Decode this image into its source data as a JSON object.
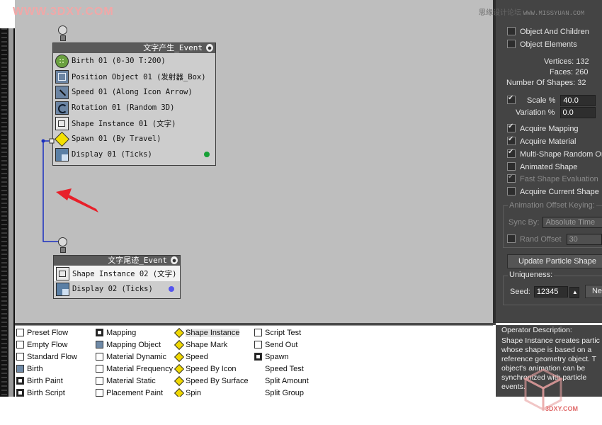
{
  "watermark": {
    "left": "WWW.3DXY.COM",
    "right_cn": "思缘设计论坛",
    "right_site": "WWW.MISSYUAN.COM",
    "logo_sub": "3DXY.COM"
  },
  "event1": {
    "title": "文字产生_Event",
    "ops": [
      {
        "label": "Birth 01 (0-30 T:200)",
        "icon": "birth-icon"
      },
      {
        "label": "Position Object 01 (发射器_Box)",
        "icon": "position-object-icon"
      },
      {
        "label": "Speed 01 (Along Icon Arrow)",
        "icon": "speed-icon"
      },
      {
        "label": "Rotation 01 (Random 3D)",
        "icon": "rotation-icon"
      },
      {
        "label": "Shape Instance 01 (文字)",
        "icon": "shape-instance-icon"
      },
      {
        "label": "Spawn 01 (By Travel)",
        "icon": "spawn-icon"
      },
      {
        "label": "Display 01 (Ticks)",
        "icon": "display-icon"
      }
    ],
    "display_color": "#16a036"
  },
  "event2": {
    "title": "文字尾迹_Event",
    "ops": [
      {
        "label": "Shape Instance 02 (文字)",
        "icon": "shape-instance-icon"
      },
      {
        "label": "Display 02 (Ticks)",
        "icon": "display-icon"
      }
    ],
    "display_color": "#5555ee"
  },
  "wire_color": "#1a2fbf",
  "annotation_arrow_color": "#e8202a",
  "panel": {
    "object_and_children": "Object And Children",
    "object_elements": "Object Elements",
    "vertices_label": "Vertices:",
    "vertices_value": "132",
    "faces_label": "Faces:",
    "faces_value": "260",
    "num_shapes_label": "Number Of Shapes:",
    "num_shapes_value": "32",
    "scale_label": "Scale %",
    "scale_value": "40.0",
    "variation_label": "Variation %",
    "variation_value": "0.0",
    "acquire_mapping": "Acquire Mapping",
    "acquire_material": "Acquire Material",
    "multi_shape": "Multi-Shape Random Ord",
    "animated_shape": "Animated Shape",
    "fast_shape": "Fast Shape Evaluation",
    "acquire_current": "Acquire Current Shape",
    "anim_offset_group": "Animation Offset Keying:",
    "sync_by_label": "Sync By:",
    "sync_by_value": "Absolute Time",
    "rand_offset_label": "Rand Offset",
    "rand_offset_value": "30",
    "update_button": "Update Particle Shape",
    "uniqueness_group": "Uniqueness:",
    "seed_label": "Seed:",
    "seed_value": "12345",
    "new_button": "New"
  },
  "depot": {
    "col1": [
      {
        "label": "Preset Flow",
        "icon": "preset-flow-icon"
      },
      {
        "label": "Empty Flow",
        "icon": "empty-flow-icon"
      },
      {
        "label": "Standard Flow",
        "icon": "standard-flow-icon"
      },
      {
        "label": "Birth",
        "icon": "birth-icon"
      },
      {
        "label": "Birth Paint",
        "icon": "birth-paint-icon"
      },
      {
        "label": "Birth Script",
        "icon": "birth-script-icon"
      }
    ],
    "col2": [
      {
        "label": "Mapping",
        "icon": "mapping-icon"
      },
      {
        "label": "Mapping Object",
        "icon": "mapping-object-icon"
      },
      {
        "label": "Material Dynamic",
        "icon": "material-dynamic-icon"
      },
      {
        "label": "Material Frequency",
        "icon": "material-frequency-icon"
      },
      {
        "label": "Material Static",
        "icon": "material-static-icon"
      },
      {
        "label": "Placement Paint",
        "icon": "placement-paint-icon"
      }
    ],
    "col3": [
      {
        "label": "Shape Instance",
        "icon": "shape-instance-icon"
      },
      {
        "label": "Shape Mark",
        "icon": "shape-mark-icon"
      },
      {
        "label": "Speed",
        "icon": "speed-icon"
      },
      {
        "label": "Speed By Icon",
        "icon": "speed-by-icon-icon"
      },
      {
        "label": "Speed By Surface",
        "icon": "speed-by-surface-icon"
      },
      {
        "label": "Spin",
        "icon": "spin-icon"
      }
    ],
    "col4": [
      {
        "label": "Script Test",
        "icon": "script-test-icon"
      },
      {
        "label": "Send Out",
        "icon": "send-out-icon"
      },
      {
        "label": "Spawn",
        "icon": "spawn-icon"
      },
      {
        "label": "Speed Test",
        "icon": "speed-test-icon"
      },
      {
        "label": "Split Amount",
        "icon": "split-amount-icon"
      },
      {
        "label": "Split Group",
        "icon": "split-group-icon"
      }
    ]
  },
  "description": {
    "title": "Operator Description:",
    "text": "Shape Instance creates partic whose shape is based on a reference geometry object. T object's animation can be synchronized with particle events."
  }
}
